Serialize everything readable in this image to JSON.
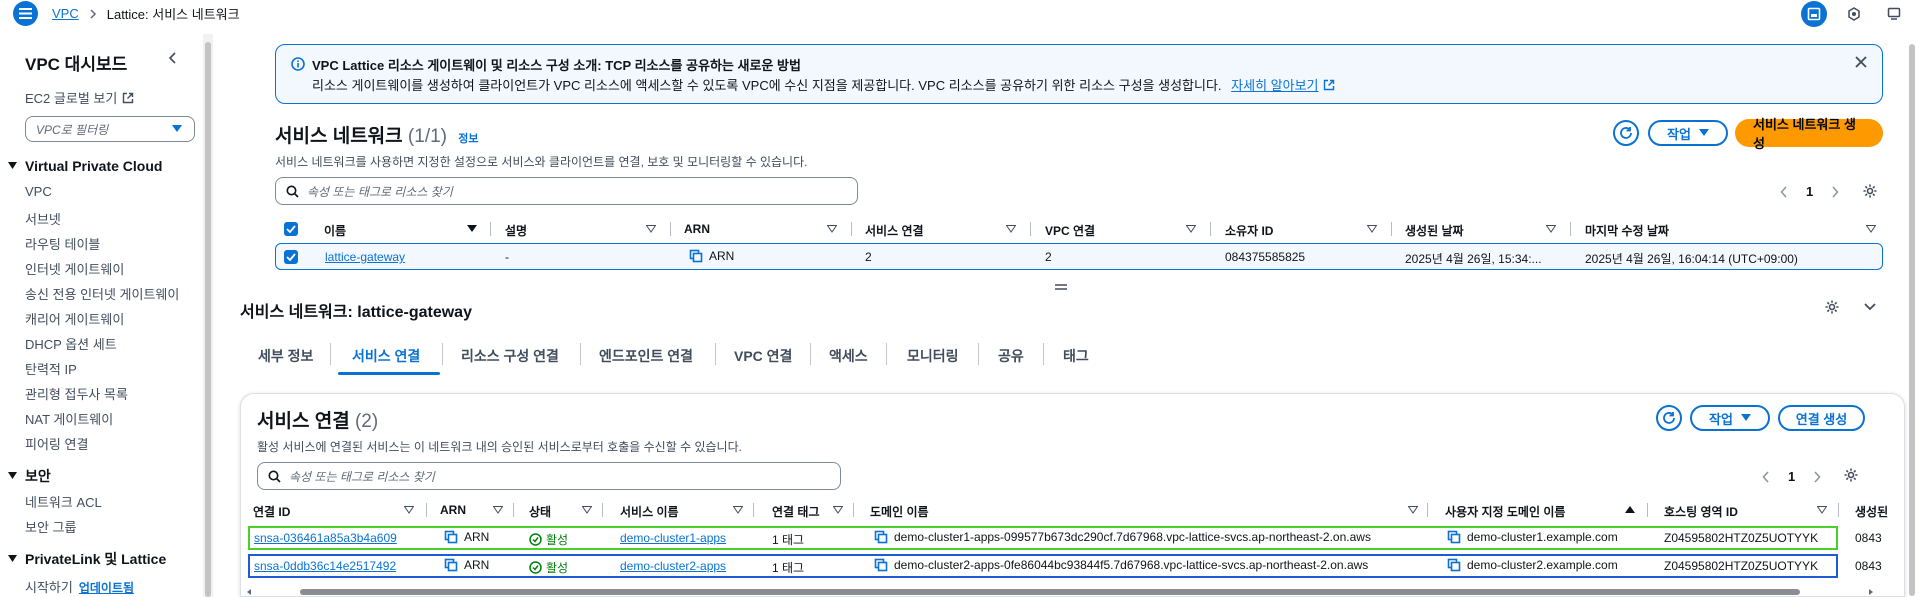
{
  "breadcrumb": {
    "root": "VPC",
    "current": "Lattice: 서비스 네트워크"
  },
  "sidebar": {
    "title": "VPC 대시보드",
    "ec2_global": "EC2 글로벌 보기",
    "filter_placeholder": "VPC로 필터링",
    "section_vpc": "Virtual Private Cloud",
    "vpc_items": [
      "VPC",
      "서브넷",
      "라우팅 테이블",
      "인터넷 게이트웨이",
      "송신 전용 인터넷 게이트웨이",
      "캐리어 게이트웨이",
      "DHCP 옵션 세트",
      "탄력적 IP",
      "관리형 접두사 목록",
      "NAT 게이트웨이",
      "피어링 연결"
    ],
    "section_security": "보안",
    "security_items": [
      "네트워크 ACL",
      "보안 그룹"
    ],
    "section_privatelink": "PrivateLink 및 Lattice",
    "privatelink_items": [
      "시작하기"
    ],
    "new_badge": "업데이트됨"
  },
  "flash": {
    "title": "VPC Lattice 리소스 게이트웨이 및 리소스 구성 소개: TCP 리소스를 공유하는 새로운 방법",
    "body": "리소스 게이트웨이를 생성하여 클라이언트가 VPC 리소스에 액세스할 수 있도록 VPC에 수신 지점을 제공합니다. VPC 리소스를 공유하기 위한 리소스 구성을 생성합니다.",
    "link": "자세히 알아보기"
  },
  "networks": {
    "title": "서비스 네트워크",
    "count": "(1/1)",
    "info": "정보",
    "description": "서비스 네트워크를 사용하면 지정한 설정으로 서비스와 클라이언트를 연결, 보호 및 모니터링할 수 있습니다.",
    "actions_label": "작업",
    "create_label": "서비스 네트워크 생성",
    "search_placeholder": "속성 또는 태그로 리소스 찾기",
    "page": "1",
    "columns": [
      "이름",
      "설명",
      "ARN",
      "서비스 연결",
      "VPC 연결",
      "소유자 ID",
      "생성된 날짜",
      "마지막 수정 날짜"
    ],
    "row": {
      "name": "lattice-gateway",
      "description": "-",
      "arn": "ARN",
      "service_assoc": "2",
      "vpc_assoc": "2",
      "owner": "084375585825",
      "created": "2025년 4월 26일, 15:34:...",
      "modified": "2025년 4월 26일, 16:04:14 (UTC+09:00)"
    }
  },
  "detail": {
    "title": "서비스 네트워크: lattice-gateway",
    "tabs": [
      "세부 정보",
      "서비스 연결",
      "리소스 구성 연결",
      "엔드포인트 연결",
      "VPC 연결",
      "액세스",
      "모니터링",
      "공유",
      "태그"
    ],
    "active_tab": "서비스 연결"
  },
  "assoc": {
    "title": "서비스 연결",
    "count": "(2)",
    "description": "활성 서비스에 연결된 서비스는 이 네트워크 내의 승인된 서비스로부터 호출을 수신할 수 있습니다.",
    "actions_label": "작업",
    "create_label": "연결 생성",
    "search_placeholder": "속성 또는 태그로 리소스 찾기",
    "page": "1",
    "columns": [
      "연결 ID",
      "ARN",
      "상태",
      "서비스 이름",
      "연결 태그",
      "도메인 이름",
      "사용자 지정 도메인 이름",
      "호스팅 영역 ID",
      "생성된"
    ],
    "rows": [
      {
        "id": "snsa-036461a85a3b4a609",
        "arn": "ARN",
        "status": "활성",
        "service": "demo-cluster1-apps",
        "tags": "1 태그",
        "domain": "demo-cluster1-apps-099577b673dc290cf.7d67968.vpc-lattice-svcs.ap-northeast-2.on.aws",
        "custom_domain": "demo-cluster1.example.com",
        "zone": "Z04595802HTZ0Z5UOTYYK",
        "created": "0843"
      },
      {
        "id": "snsa-0ddb36c14e2517492",
        "arn": "ARN",
        "status": "활성",
        "service": "demo-cluster2-apps",
        "tags": "1 태그",
        "domain": "demo-cluster2-apps-0fe86044bc93844f5.7d67968.vpc-lattice-svcs.ap-northeast-2.on.aws",
        "custom_domain": "demo-cluster2.example.com",
        "zone": "Z04595802HTZ0Z5UOTYYK",
        "created": "0843"
      }
    ]
  },
  "colors": {
    "accent": "#0972d3",
    "primary": "#ff9900",
    "success": "#037f0c",
    "highlight_green": "#4bd02b",
    "highlight_blue": "#1e5bd6"
  }
}
